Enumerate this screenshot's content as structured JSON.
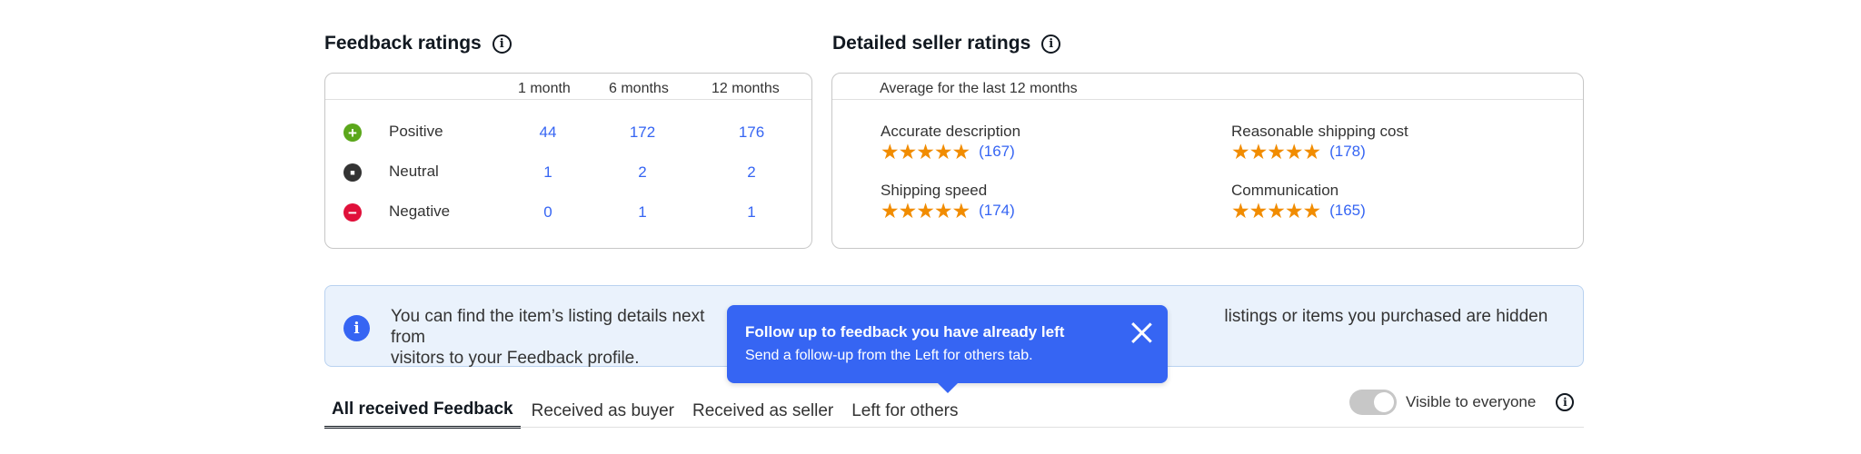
{
  "feedback_ratings": {
    "title": "Feedback ratings",
    "columns": [
      "1 month",
      "6 months",
      "12 months"
    ],
    "rows": [
      {
        "label": "Positive",
        "values": [
          "44",
          "172",
          "176"
        ],
        "color": "#5ba71b"
      },
      {
        "label": "Neutral",
        "values": [
          "1",
          "2",
          "2"
        ],
        "color": "#333333"
      },
      {
        "label": "Negative",
        "values": [
          "0",
          "1",
          "1"
        ],
        "color": "#e0103a"
      }
    ]
  },
  "detailed_seller_ratings": {
    "title": "Detailed seller ratings",
    "subtitle": "Average for the last 12 months",
    "items": [
      {
        "label": "Accurate description",
        "count": "(167)",
        "stars": 5
      },
      {
        "label": "Reasonable shipping cost",
        "count": "(178)",
        "stars": 5
      },
      {
        "label": "Shipping speed",
        "count": "(174)",
        "stars": 5
      },
      {
        "label": "Communication",
        "count": "(165)",
        "stars": 5
      }
    ],
    "star_glyphs": "★★★★★"
  },
  "banner": {
    "line1_left": "You can find the item’s listing details next",
    "line1_right": "listings or items you purchased are hidden from",
    "line2": "visitors to your Feedback profile."
  },
  "tooltip": {
    "title": "Follow up to feedback you have already left",
    "body": "Send a follow-up from the Left for others tab."
  },
  "tabs": [
    {
      "label": "All received Feedback",
      "active": true
    },
    {
      "label": "Received as buyer",
      "active": false
    },
    {
      "label": "Received as seller",
      "active": false
    },
    {
      "label": "Left for others",
      "active": false
    }
  ],
  "visibility": {
    "label": "Visible to everyone",
    "enabled": true
  },
  "icons": {
    "info": "i",
    "plus": "+",
    "neutral": "■",
    "minus": "−"
  }
}
